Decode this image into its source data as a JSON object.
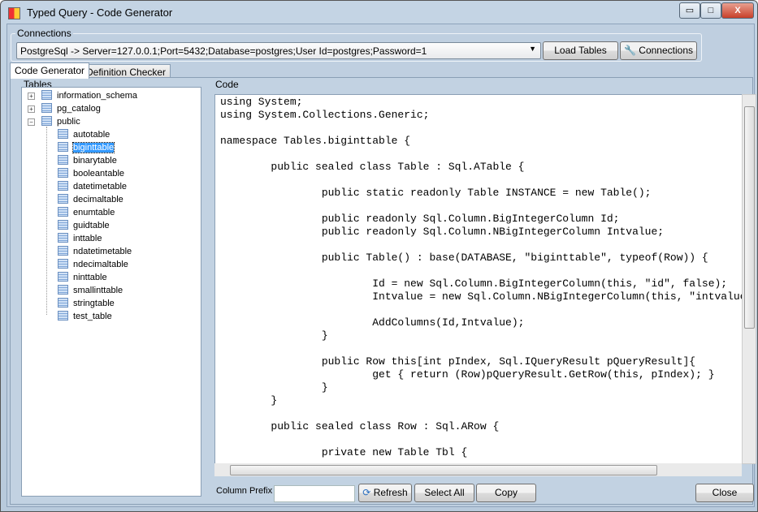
{
  "window": {
    "title": "Typed Query - Code Generator",
    "minimize": "▭",
    "maximize": "□",
    "close": "X"
  },
  "connections": {
    "label": "Connections",
    "selected": "PostgreSql -> Server=127.0.0.1;Port=5432;Database=postgres;User Id=postgres;Password=1",
    "load_tables": "Load Tables",
    "connections_button": "Connections"
  },
  "tabs": [
    {
      "label": "Code Generator",
      "active": true
    },
    {
      "label": "Definition Checker",
      "active": false
    }
  ],
  "tables": {
    "label": "Tables",
    "roots": [
      "information_schema",
      "pg_catalog",
      "public"
    ],
    "items": [
      "autotable",
      "biginttable",
      "binarytable",
      "booleantable",
      "datetimetable",
      "decimaltable",
      "enumtable",
      "guidtable",
      "inttable",
      "ndatetimetable",
      "ndecimaltable",
      "ninttable",
      "smallinttable",
      "stringtable",
      "test_table"
    ],
    "selected": "biginttable"
  },
  "code": {
    "label": "Code",
    "text": "using System;\nusing System.Collections.Generic;\n\nnamespace Tables.biginttable {\n\n        public sealed class Table : Sql.ATable {\n\n                public static readonly Table INSTANCE = new Table();\n\n                public readonly Sql.Column.BigIntegerColumn Id;\n                public readonly Sql.Column.NBigIntegerColumn Intvalue;\n\n                public Table() : base(DATABASE, \"biginttable\", typeof(Row)) {\n\n                        Id = new Sql.Column.BigIntegerColumn(this, \"id\", false);\n                        Intvalue = new Sql.Column.NBigIntegerColumn(this, \"intvalue\", true);\n\n                        AddColumns(Id,Intvalue);\n                }\n\n                public Row this[int pIndex, Sql.IQueryResult pQueryResult]{\n                        get { return (Row)pQueryResult.GetRow(this, pIndex); }\n                }\n        }\n\n        public sealed class Row : Sql.ARow {\n\n                private new Table Tbl {"
  },
  "footer": {
    "column_prefix_label": "Column Prefix",
    "column_prefix_value": "",
    "refresh": "Refresh",
    "select_all": "Select All",
    "copy": "Copy",
    "close": "Close"
  }
}
